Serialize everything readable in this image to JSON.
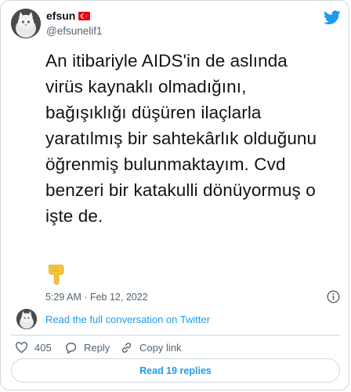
{
  "colors": {
    "brand": "#1d9bf0",
    "text_primary": "#0f1419",
    "text_secondary": "#536471",
    "like_heart": "#536471",
    "border": "#cfd9de"
  },
  "author": {
    "display_name": "efsun",
    "handle": "@efsunelif1",
    "flag_icon": "turkey-flag-icon",
    "avatar_icon": "cat-avatar"
  },
  "tweet": {
    "text_lines": [
      "An itibariyle AIDS'in de aslında",
      "virüs kaynaklı olmadığını,",
      "bağışıklığı düşüren ilaçlarla",
      "yaratılmış bir sahtekârlık olduğunu",
      "öğrenmiş bulunmaktayım. Cvd",
      "benzeri bir katakulli dönüyormuş o",
      "işte de."
    ],
    "emoji_icon": "backhand-pointing-down-icon",
    "timestamp": "5:29 AM · Feb 12, 2022"
  },
  "conversation": {
    "link_text": "Read the full conversation on Twitter"
  },
  "actions": {
    "like_count": "405",
    "reply_label": "Reply",
    "copy_link_label": "Copy link"
  },
  "footer": {
    "read_replies_label": "Read 19 replies"
  }
}
